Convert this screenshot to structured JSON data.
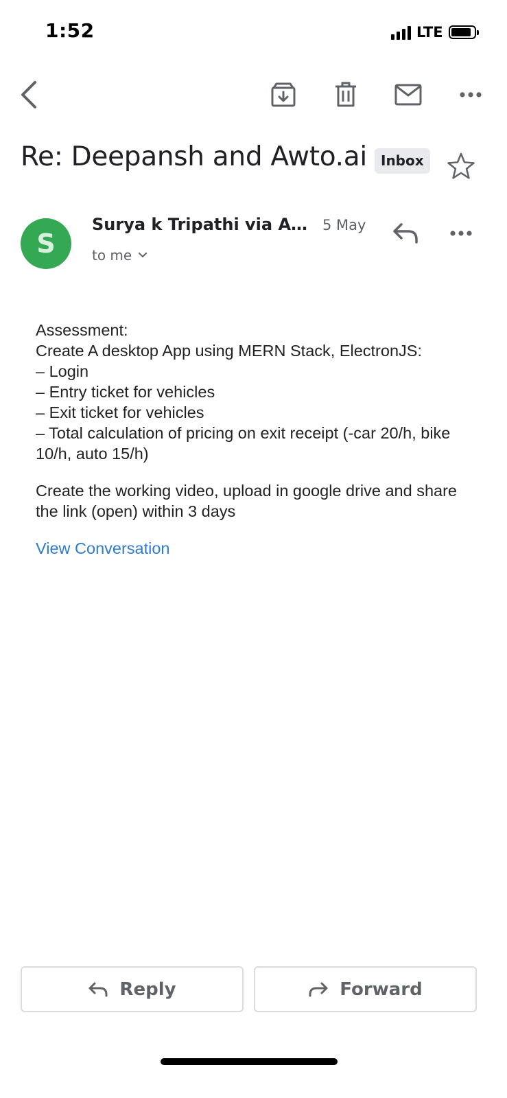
{
  "status_bar": {
    "time": "1:52",
    "network": "LTE",
    "signal_bars": 4,
    "battery_level": 0.9
  },
  "toolbar": {
    "icons": [
      "back-icon",
      "archive-icon",
      "delete-icon",
      "mark-unread-icon",
      "more-icon"
    ]
  },
  "email": {
    "subject": "Re: Deepansh and Awto.ai",
    "label": "Inbox",
    "starred": false
  },
  "sender": {
    "avatar_letter": "S",
    "avatar_color": "#34a853",
    "name": "Surya k Tripathi via Ang...",
    "date": "5 May",
    "recipient": "to me"
  },
  "body": {
    "paragraph_1": "Assessment:\nCreate A desktop App using MERN Stack, ElectronJS:\n– Login\n– Entry ticket for vehicles\n– Exit ticket for vehicles\n– Total calculation of pricing on exit receipt (-car 20/h, bike 10/h, auto 15/h)",
    "paragraph_2": "Create the working video, upload in google drive and share the link (open) within 3 days",
    "link_text": "View Conversation",
    "link_color": "#2e7bcf"
  },
  "actions": {
    "reply_label": "Reply",
    "forward_label": "Forward"
  }
}
